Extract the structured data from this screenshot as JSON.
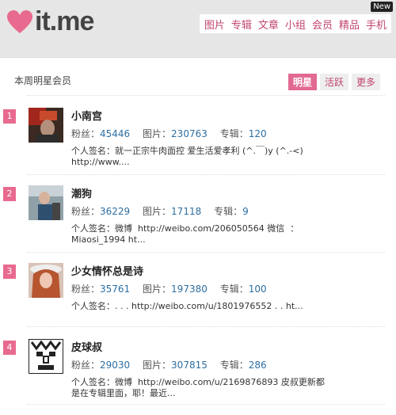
{
  "header": {
    "logo_text": "it.me",
    "new_badge": "New",
    "nav": [
      "图片",
      "专辑",
      "文章",
      "小组",
      "会员",
      "精品",
      "手机"
    ]
  },
  "section": {
    "title": "本周明星会员",
    "tabs": [
      {
        "label": "明星",
        "active": true
      },
      {
        "label": "活跃",
        "active": false
      },
      {
        "label": "更多",
        "active": false
      }
    ]
  },
  "labels": {
    "fans": "粉丝：",
    "images": "图片：",
    "albums": "专辑：",
    "signature": "个人签名："
  },
  "members": [
    {
      "rank": "1",
      "name": "小南宫",
      "fans": "45446",
      "images": "230763",
      "albums": "120",
      "signature": "就一正宗牛肉面控 爱生活爱孝利 (^.￣)y (^.-<)\nhttp://www...."
    },
    {
      "rank": "2",
      "name": "潮狗",
      "fans": "36229",
      "images": "17118",
      "albums": "9",
      "signature": "微博  http://weibo.com/206050564 微信  ：\nMiaosi_1994 ht..."
    },
    {
      "rank": "3",
      "name": "少女情怀总是诗",
      "fans": "35761",
      "images": "197380",
      "albums": "100",
      "signature": ". . . http://weibo.com/u/1801976552 . . ht..."
    },
    {
      "rank": "4",
      "name": "皮球叔",
      "fans": "29030",
      "images": "307815",
      "albums": "286",
      "signature": "微博  http://weibo.com/u/2169876893 皮叔更新都是在专辑里面，耶！最近..."
    }
  ],
  "colors": {
    "accent": "#e26a92",
    "link": "#2d6ea1",
    "nav": "#c2446f"
  }
}
